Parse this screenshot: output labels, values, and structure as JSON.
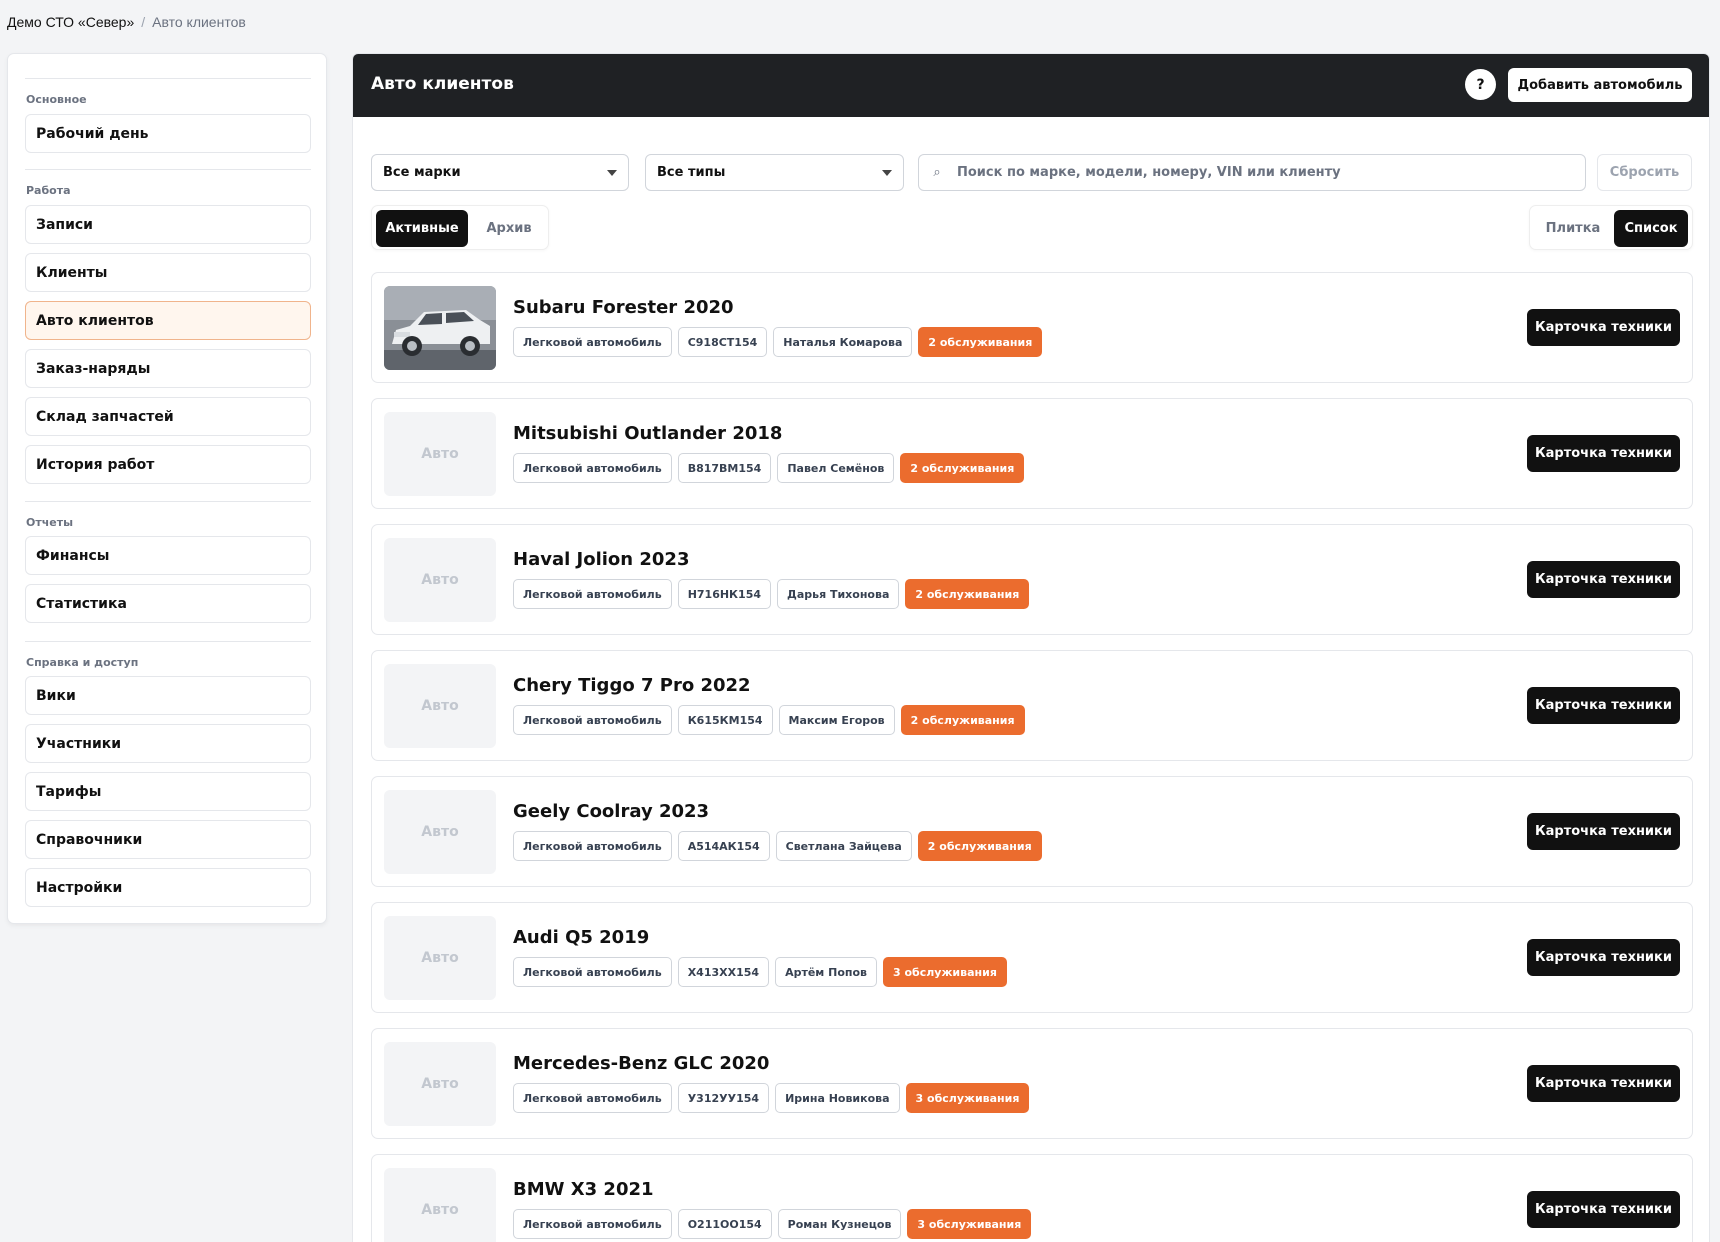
{
  "breadcrumb": {
    "root": "Демо СТО «Север»",
    "separator": "/",
    "current": "Авто клиентов"
  },
  "sidebar": {
    "sections": [
      {
        "title": "Основное",
        "items": [
          {
            "label": "Рабочий день"
          }
        ]
      },
      {
        "title": "Работа",
        "items": [
          {
            "label": "Записи"
          },
          {
            "label": "Клиенты"
          },
          {
            "label": "Авто клиентов",
            "active": true
          },
          {
            "label": "Заказ-наряды"
          },
          {
            "label": "Склад запчастей"
          },
          {
            "label": "История работ"
          }
        ]
      },
      {
        "title": "Отчеты",
        "items": [
          {
            "label": "Финансы"
          },
          {
            "label": "Статистика"
          }
        ]
      },
      {
        "title": "Справка и доступ",
        "items": [
          {
            "label": "Вики"
          },
          {
            "label": "Участники"
          },
          {
            "label": "Тарифы"
          },
          {
            "label": "Справочники"
          },
          {
            "label": "Настройки"
          }
        ]
      }
    ]
  },
  "main": {
    "title": "Авто клиентов",
    "help_label": "?",
    "add_label": "Добавить автомобиль",
    "filters": {
      "brand": "Все марки",
      "type": "Все типы",
      "search_placeholder": "Поиск по марке, модели, номеру, VIN или клиенту",
      "search_value": "",
      "search_icon": "⌕",
      "reset_label": "Сбросить"
    },
    "status_tabs": [
      {
        "label": "Активные",
        "selected": true
      },
      {
        "label": "Архив",
        "selected": false
      }
    ],
    "view_tabs": [
      {
        "label": "Плитка",
        "selected": false
      },
      {
        "label": "Список",
        "selected": true
      }
    ],
    "placeholder_thumb": "Авто",
    "card_button": "Карточка техники",
    "cars": [
      {
        "title": "Subaru Forester 2020",
        "type": "Легковой автомобиль",
        "plate": "С918СТ154",
        "owner": "Наталья Комарова",
        "services": "2 обслуживания",
        "has_photo": true
      },
      {
        "title": "Mitsubishi Outlander 2018",
        "type": "Легковой автомобиль",
        "plate": "В817ВМ154",
        "owner": "Павел Семёнов",
        "services": "2 обслуживания",
        "has_photo": false
      },
      {
        "title": "Haval Jolion 2023",
        "type": "Легковой автомобиль",
        "plate": "Н716НК154",
        "owner": "Дарья Тихонова",
        "services": "2 обслуживания",
        "has_photo": false
      },
      {
        "title": "Chery Tiggo 7 Pro 2022",
        "type": "Легковой автомобиль",
        "plate": "К615КМ154",
        "owner": "Максим Егоров",
        "services": "2 обслуживания",
        "has_photo": false
      },
      {
        "title": "Geely Coolray 2023",
        "type": "Легковой автомобиль",
        "plate": "А514АК154",
        "owner": "Светлана Зайцева",
        "services": "2 обслуживания",
        "has_photo": false
      },
      {
        "title": "Audi Q5 2019",
        "type": "Легковой автомобиль",
        "plate": "Х413ХХ154",
        "owner": "Артём Попов",
        "services": "3 обслуживания",
        "has_photo": false
      },
      {
        "title": "Mercedes-Benz GLC 2020",
        "type": "Легковой автомобиль",
        "plate": "У312УУ154",
        "owner": "Ирина Новикова",
        "services": "3 обслуживания",
        "has_photo": false
      },
      {
        "title": "BMW X3 2021",
        "type": "Легковой автомобиль",
        "plate": "О211ОО154",
        "owner": "Роман Кузнецов",
        "services": "3 обслуживания",
        "has_photo": false
      }
    ]
  },
  "colors": {
    "header_bg": "#1f2124",
    "accent_orange": "#eb6c2e",
    "active_nav_bg": "#fff6ee",
    "active_nav_border": "#f0b48c",
    "dark_button": "#111111"
  }
}
